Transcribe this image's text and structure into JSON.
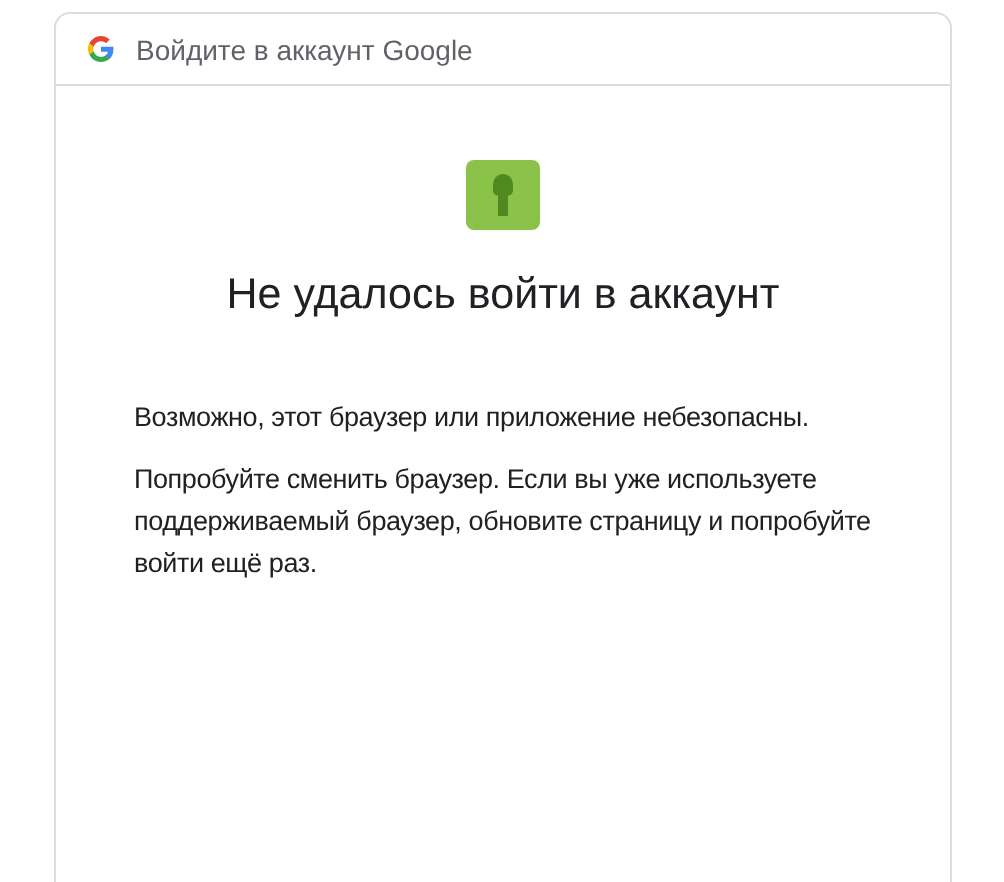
{
  "header": {
    "title": "Войдите в аккаунт Google"
  },
  "main": {
    "heading": "Не удалось войти в аккаунт",
    "paragraphs": [
      "Возможно, этот браузер или приложение небезопасны.",
      "Попробуйте сменить браузер. Если вы уже используете поддерживаемый браузер, обновите страницу и попробуйте войти ещё раз."
    ]
  }
}
